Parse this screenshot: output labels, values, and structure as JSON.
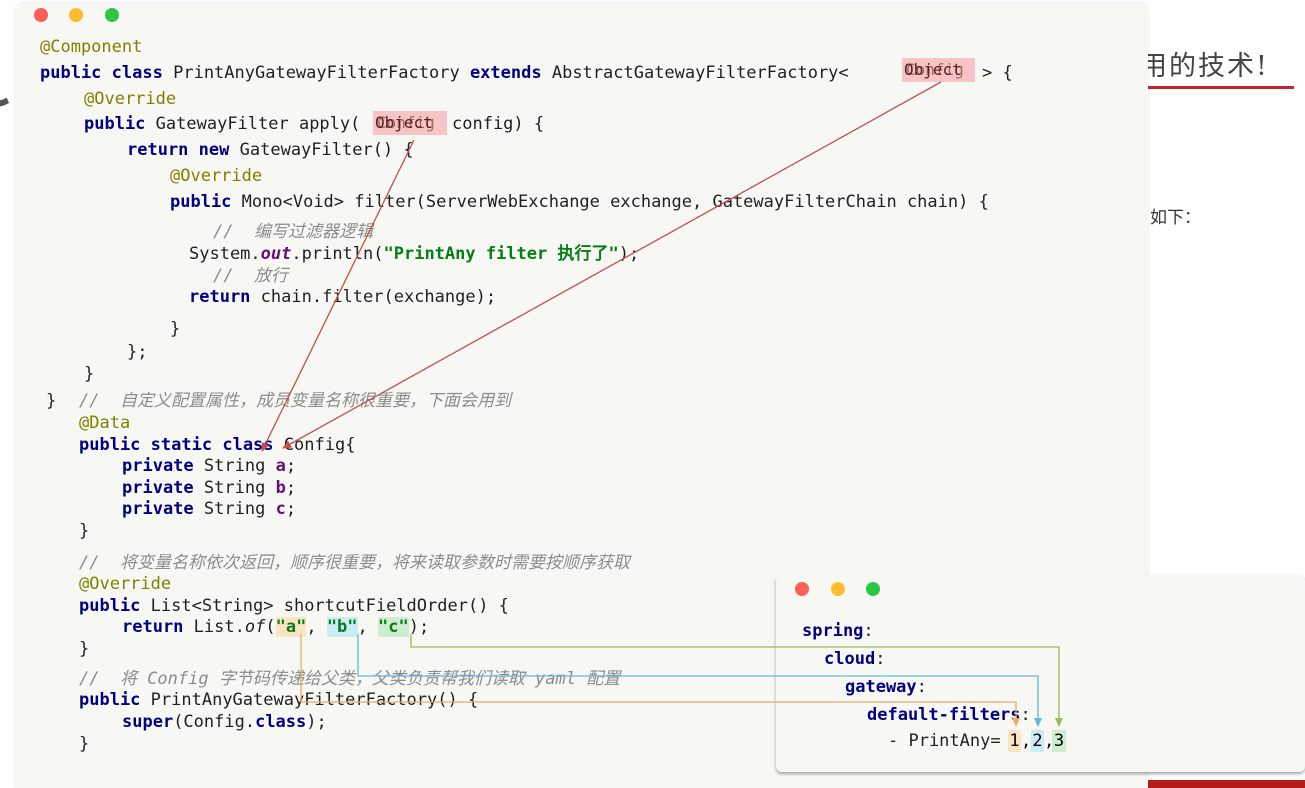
{
  "background": {
    "heading": "用的技术!",
    "text": "如下："
  },
  "code": {
    "l1": "@Component",
    "l2_public": "public",
    "l2_class": "class",
    "l2_name": "PrintAnyGatewayFilterFactory",
    "l2_extends": "extends",
    "l2_parent": "AbstractGatewayFilterFactory<",
    "l2_end": "> {",
    "override": "@Override",
    "l4_public": "public",
    "l4_sig_a": "GatewayFilter apply(",
    "l4_sig_b": "config) {",
    "l5_return": "return",
    "l5_new": "new",
    "l5_rest": "GatewayFilter() {",
    "l7_public": "public",
    "l7_rest": "Mono<Void> filter(ServerWebExchange exchange, GatewayFilterChain chain) {",
    "comment_write": "//  编写过滤器逻辑",
    "println_a": "System.",
    "println_out": "out",
    "println_b": ".println(",
    "println_str": "\"PrintAny filter 执行了\"",
    "println_c": ");",
    "comment_pass": "//  放行",
    "return_chain_kw": "return",
    "return_chain_rest": "chain.filter(exchange);",
    "brace_close": "}",
    "brace_semicolon": "};",
    "comment_config": "//  自定义配置属性，成员变量名称很重要，下面会用到",
    "data_annotation": "@Data",
    "config_public": "public",
    "config_static": "static",
    "config_class": "class",
    "config_name": "Config{",
    "private_kw": "private",
    "string_type": "String",
    "field_a": "a",
    "field_b": "b",
    "field_c": "c",
    "semicolon": ";",
    "comment_order": "//  将变量名称依次返回，顺序很重要，将来读取参数时需要按顺序获取",
    "list_public": "public",
    "list_sig": "List<String> shortcutFieldOrder() {",
    "list_return": "return",
    "list_call_a": "List.",
    "list_of": "of",
    "list_paren": "(",
    "str_a": "\"a\"",
    "str_b": "\"b\"",
    "str_c": "\"c\"",
    "comma": ",",
    "list_end": ");",
    "comment_super": "//  将 Config 字节码传递给父类，父类负责帮我们读取 yaml 配置",
    "ctor_public": "public",
    "ctor_sig": "PrintAnyGatewayFilterFactory() {",
    "super_kw": "super",
    "super_a": "(Config.",
    "super_class": "class",
    "super_b": ");",
    "badge_main": "Object",
    "badge_ghost": "Config"
  },
  "yaml": {
    "spring": "spring",
    "cloud": "cloud",
    "gateway": "gateway",
    "default_filters": "default-filters",
    "colon": ":",
    "item_prefix": "- PrintAny=",
    "v1": "1",
    "v2": "2",
    "v3": "3",
    "comma": ","
  },
  "colors": {
    "arrow_red": "#c0504d",
    "arrow_orange": "#f0a868",
    "arrow_blue": "#5fb7d9",
    "arrow_green": "#9bbb59"
  }
}
